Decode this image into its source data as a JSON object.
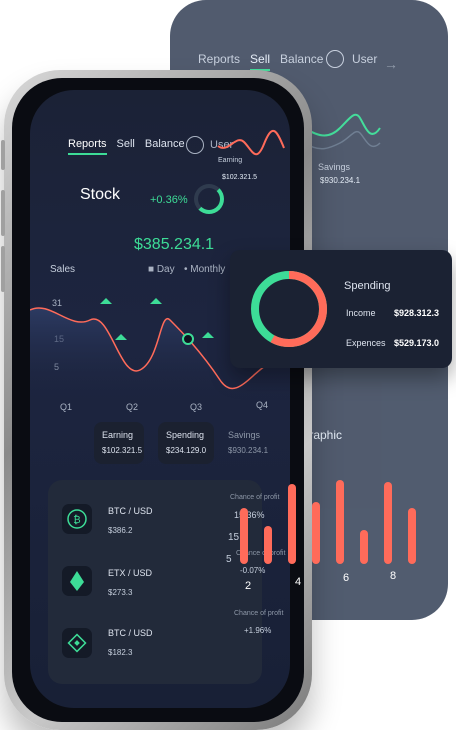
{
  "colors": {
    "accent_green": "#3ddc97",
    "accent_red": "#ff6b5a",
    "panel": "#1b2130"
  },
  "back_panel": {
    "nav": [
      "Reports",
      "Sell",
      "Balance"
    ],
    "active_nav": "Sell",
    "user": "User",
    "savings_label": "Savings",
    "savings_value": "$930.234.1",
    "graphic_label": "Graphic"
  },
  "screen": {
    "nav": {
      "reports": "Reports",
      "sell": "Sell",
      "balance": "Balance",
      "user": "User"
    },
    "stock_title": "Stock",
    "stock_change": "+0.36%",
    "stock_price": "$385.234.1",
    "sales_label": "Sales",
    "toggle_day": "Day",
    "toggle_monthly": "Monthly",
    "y_ticks": [
      "31",
      "15",
      "5"
    ],
    "x_ticks": [
      "Q1",
      "Q2",
      "Q3",
      "Q4"
    ],
    "cards": [
      {
        "title": "Earning",
        "value": "$102.321.5"
      },
      {
        "title": "Spending",
        "value": "$234.129.0"
      },
      {
        "title": "Savings",
        "value": "$930.234.1"
      }
    ],
    "assets": [
      {
        "name": "BTC / USD",
        "value": "$386.2",
        "icon": "bitcoin-icon"
      },
      {
        "name": "ETX / USD",
        "value": "$273.3",
        "icon": "ethereum-icon"
      },
      {
        "name": "BTC / USD",
        "value": "$182.3",
        "icon": "binance-icon"
      }
    ],
    "right": {
      "chance1": "Chance of profit",
      "pct1": "15.36%",
      "chance2": "Chance of profit",
      "pct2": "-0.07%",
      "chance3": "Chance of profit",
      "pct3": "+1.96%",
      "tick15": "15",
      "tick5": "5"
    }
  },
  "earning_mini": {
    "title": "Earning",
    "value": "$102.321.5"
  },
  "spending_card": {
    "title": "Spending",
    "income_label": "Income",
    "income_value": "$928.312.3",
    "expenses_label": "Expences",
    "expenses_value": "$529.173.0",
    "income_fraction": 0.58
  },
  "bar_chart": {
    "x_labels": [
      "2",
      "4",
      "6",
      "8"
    ],
    "values": [
      56,
      38,
      80,
      62,
      84,
      34,
      82,
      56
    ]
  }
}
